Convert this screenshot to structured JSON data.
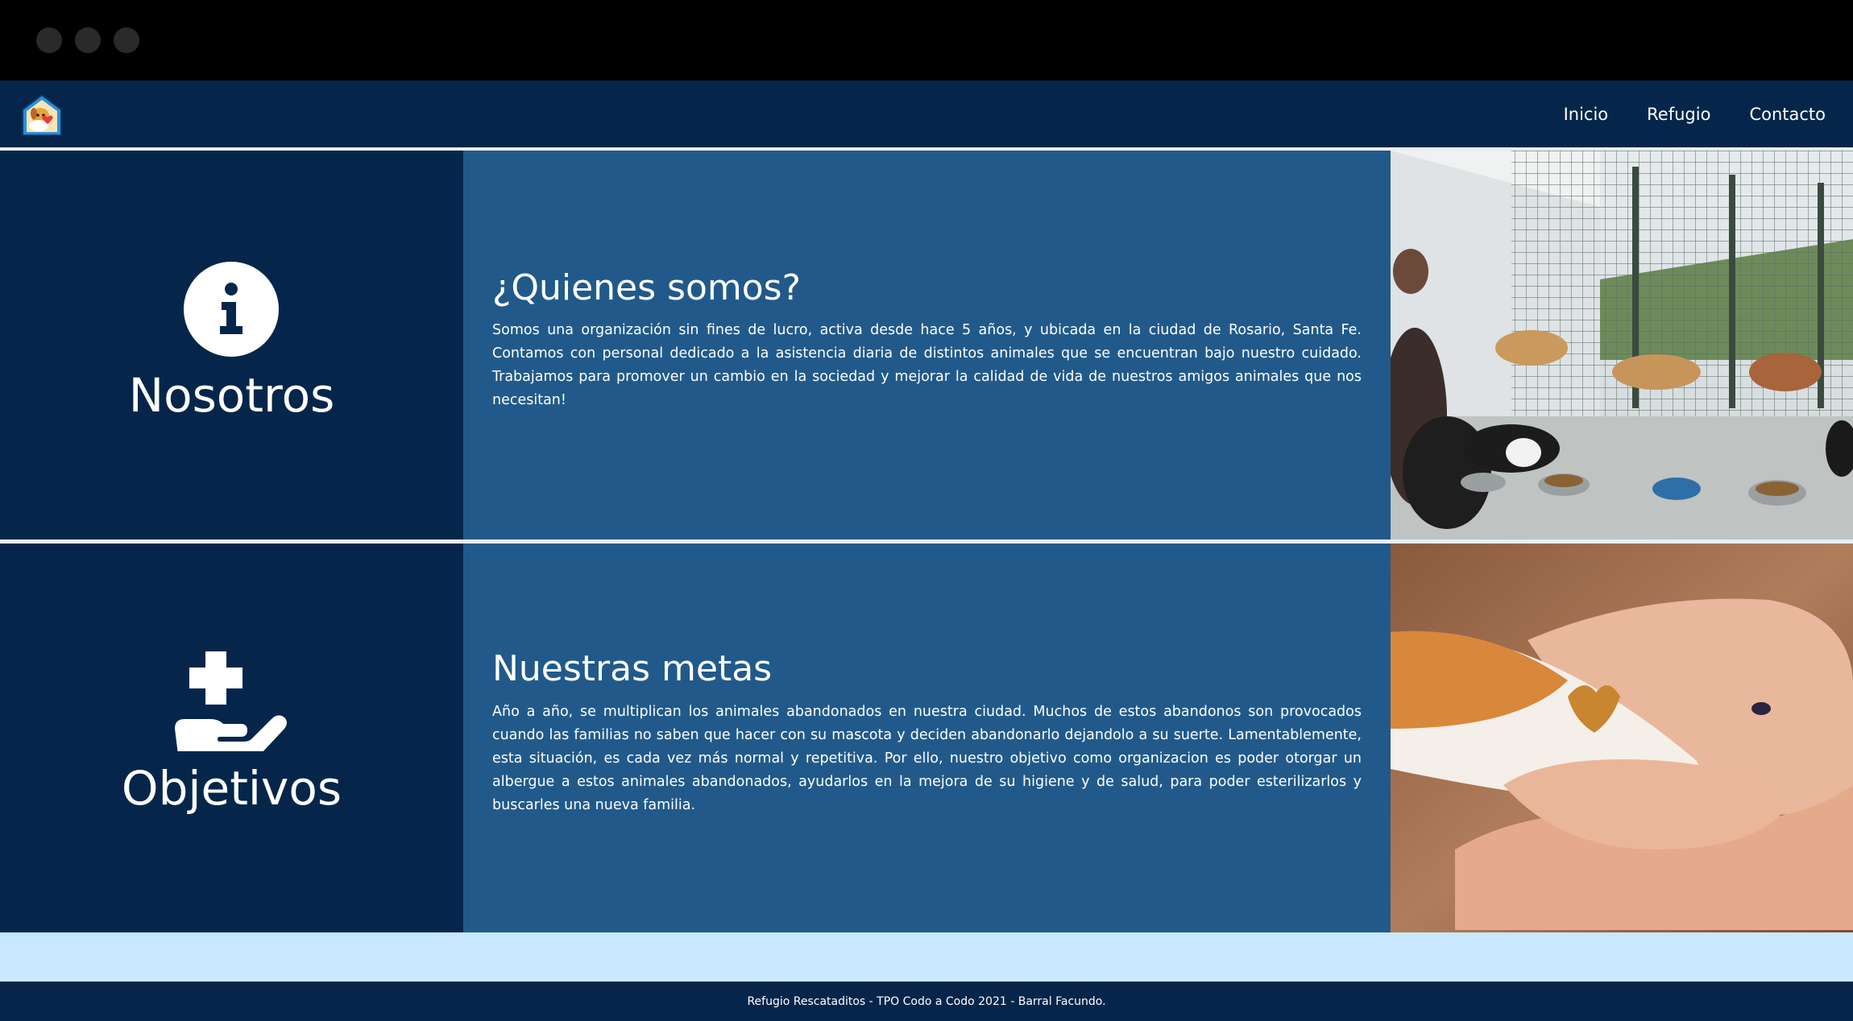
{
  "nav": {
    "links": [
      "Inicio",
      "Refugio",
      "Contacto"
    ]
  },
  "sections": [
    {
      "side_label": "Nosotros",
      "icon": "info-circle-icon",
      "title": "¿Quienes somos?",
      "text": "Somos una organización sin fines de lucro, activa desde hace 5 años, y ubicada en la ciudad de Rosario, Santa Fe. Contamos con personal dedicado a la asistencia diaria de distintos animales que se encuentran bajo nuestro cuidado. Trabajamos para promover un cambio en la sociedad y mejorar la calidad de vida de nuestros amigos animales que nos necesitan!",
      "photo": "shelter-dogs-photo"
    },
    {
      "side_label": "Objetivos",
      "icon": "hand-holding-medical-icon",
      "title": "Nuestras metas",
      "text": "Año a año, se multiplican los animales abandonados en nuestra ciudad. Muchos de estos abandonos son provocados cuando las familias no saben que hacer con su mascota y deciden abandonarlo dejandolo a su suerte. Lamentablemente, esta situación, es cada vez más normal y repetitiva. Por ello, nuestro objetivo como organizacion es poder otorgar un albergue a estos animales abandonados, ayudarlos en la mejora de su higiene y de salud, para poder esterilizarlos y buscarles una nueva familia.",
      "photo": "hands-holding-paw-photo"
    }
  ],
  "footer": {
    "text": "Refugio Rescataditos - TPO Codo a Codo 2021 - Barral Facundo."
  },
  "colors": {
    "navy": "#05264a",
    "content_blue": "#215a8a",
    "light_band": "#c8e8ff"
  }
}
